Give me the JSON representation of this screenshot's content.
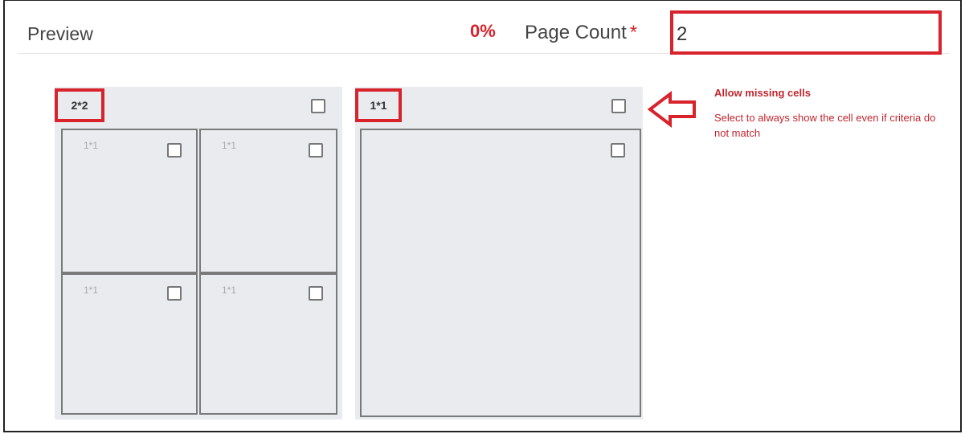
{
  "header": {
    "title": "Preview",
    "progress_text": "0%",
    "page_count_label": "Page Count",
    "required_mark": "*",
    "page_count_value": "2"
  },
  "layouts": [
    {
      "tag": "2*2",
      "cells": [
        {
          "label": "1*1"
        },
        {
          "label": "1*1"
        },
        {
          "label": "1*1"
        },
        {
          "label": "1*1"
        }
      ]
    },
    {
      "tag": "1*1",
      "cells": [
        {
          "label": ""
        }
      ]
    }
  ],
  "annotation": {
    "title": "Allow missing cells",
    "description": "Select to always show the cell even if criteria do not match"
  },
  "colors": {
    "accent": "#d8222c",
    "panel_bg": "#e9ebee"
  },
  "icons": {
    "checkbox": "checkbox-icon",
    "arrow": "arrow-left-icon"
  }
}
